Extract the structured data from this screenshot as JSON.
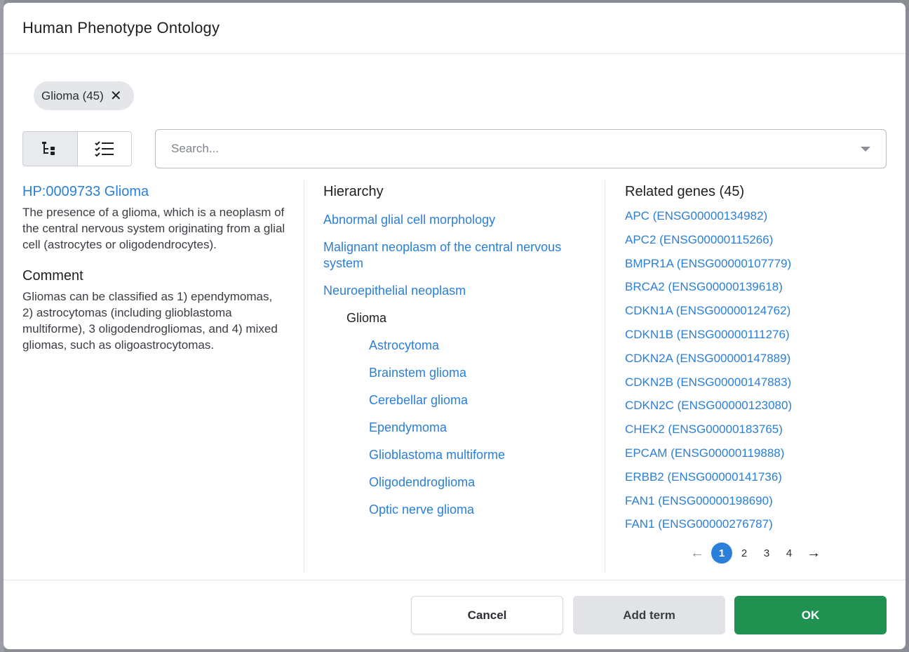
{
  "modal": {
    "title": "Human Phenotype Ontology"
  },
  "chip": {
    "label": "Glioma (45)",
    "close_glyph": "✕"
  },
  "view_toggle": {
    "tree_icon": "tree-view-icon",
    "list_icon": "checklist-icon"
  },
  "search": {
    "placeholder": "Search...",
    "value": ""
  },
  "term": {
    "title": "HP:0009733 Glioma",
    "description": "The presence of a glioma, which is a neoplasm of the central nervous system originating from a glial cell (astrocytes or oligodendrocytes).",
    "comment_heading": "Comment",
    "comment": "Gliomas can be classified as 1) ependymomas, 2) astrocytomas (including glioblastoma multiforme), 3 oligodendrogliomas, and 4) mixed gliomas, such as oligoastrocytomas."
  },
  "hierarchy": {
    "heading": "Hierarchy",
    "parents": [
      "Abnormal glial cell morphology",
      "Malignant neoplasm of the central nervous system",
      "Neuroepithelial neoplasm"
    ],
    "current": "Glioma",
    "children": [
      "Astrocytoma",
      "Brainstem glioma",
      "Cerebellar glioma",
      "Ependymoma",
      "Glioblastoma multiforme",
      "Oligodendroglioma",
      "Optic nerve glioma"
    ]
  },
  "genes": {
    "heading": "Related genes (45)",
    "items": [
      "APC (ENSG00000134982)",
      "APC2 (ENSG00000115266)",
      "BMPR1A (ENSG00000107779)",
      "BRCA2 (ENSG00000139618)",
      "CDKN1A (ENSG00000124762)",
      "CDKN1B (ENSG00000111276)",
      "CDKN2A (ENSG00000147889)",
      "CDKN2B (ENSG00000147883)",
      "CDKN2C (ENSG00000123080)",
      "CHEK2 (ENSG00000183765)",
      "EPCAM (ENSG00000119888)",
      "ERBB2 (ENSG00000141736)",
      "FAN1 (ENSG00000198690)",
      "FAN1 (ENSG00000276787)"
    ]
  },
  "pagination": {
    "prev": "←",
    "next": "→",
    "pages": [
      "1",
      "2",
      "3",
      "4"
    ],
    "current": "1"
  },
  "footer": {
    "cancel_label": "Cancel",
    "add_term_label": "Add term",
    "ok_label": "OK"
  },
  "colors": {
    "accent": "#2a7fd9",
    "ok_green": "#1f9150"
  }
}
